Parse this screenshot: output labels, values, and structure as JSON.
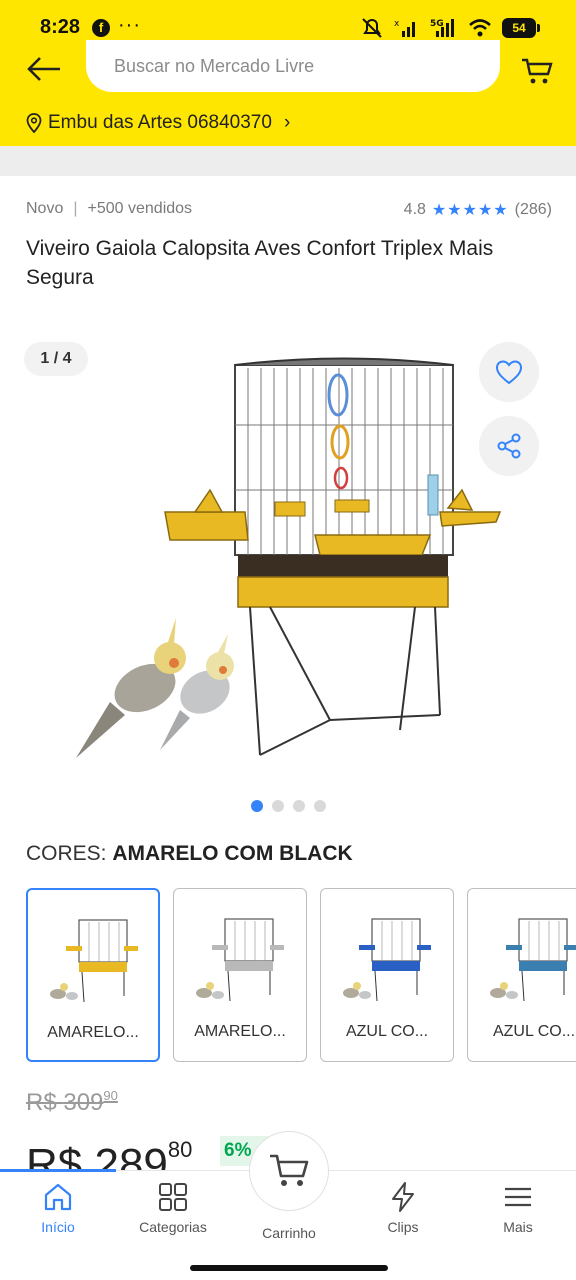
{
  "status_bar": {
    "time": "8:28",
    "app_icon": "f",
    "more": "···",
    "network": "5G",
    "battery": "54"
  },
  "header": {
    "search_placeholder": "Buscar no Mercado Livre",
    "location": "Embu das Artes 06840370",
    "location_chevron": "›"
  },
  "product": {
    "condition": "Novo",
    "separator": "|",
    "sold": "+500 vendidos",
    "rating": "4.8",
    "stars": "★★★★★",
    "reviews": "(286)",
    "title": "Viveiro Gaiola Calopsita Aves Confort Triplex Mais Segura"
  },
  "gallery": {
    "page_indicator": "1 / 4",
    "dots": 4,
    "active_dot": 0
  },
  "colors": {
    "label": "CORES: ",
    "selected": "AMARELO COM BLACK",
    "variants": [
      {
        "label": "AMARELO...",
        "tray": "#e8b923",
        "selected": true
      },
      {
        "label": "AMARELO...",
        "tray": "#b9b9b9",
        "selected": false
      },
      {
        "label": "AZUL CO...",
        "tray": "#2a5fc4",
        "selected": false
      },
      {
        "label": "AZUL CO...",
        "tray": "#3a7fb0",
        "selected": false
      }
    ]
  },
  "price": {
    "old_currency": "R$ ",
    "old_integer": "309",
    "old_cents": "90",
    "currency": "R$ ",
    "integer": "289",
    "cents": "80",
    "discount": "6%"
  },
  "bottom_nav": {
    "items": [
      {
        "label": "Início",
        "icon": "home-icon",
        "active": true
      },
      {
        "label": "Categorias",
        "icon": "grid-icon",
        "active": false
      },
      {
        "label": "Carrinho",
        "icon": "cart-icon",
        "active": false
      },
      {
        "label": "Clips",
        "icon": "bolt-icon",
        "active": false
      },
      {
        "label": "Mais",
        "icon": "menu-icon",
        "active": false
      }
    ]
  },
  "theme": {
    "brand_yellow": "#ffe600",
    "accent_blue": "#3483fa",
    "discount_green": "#00a650"
  }
}
